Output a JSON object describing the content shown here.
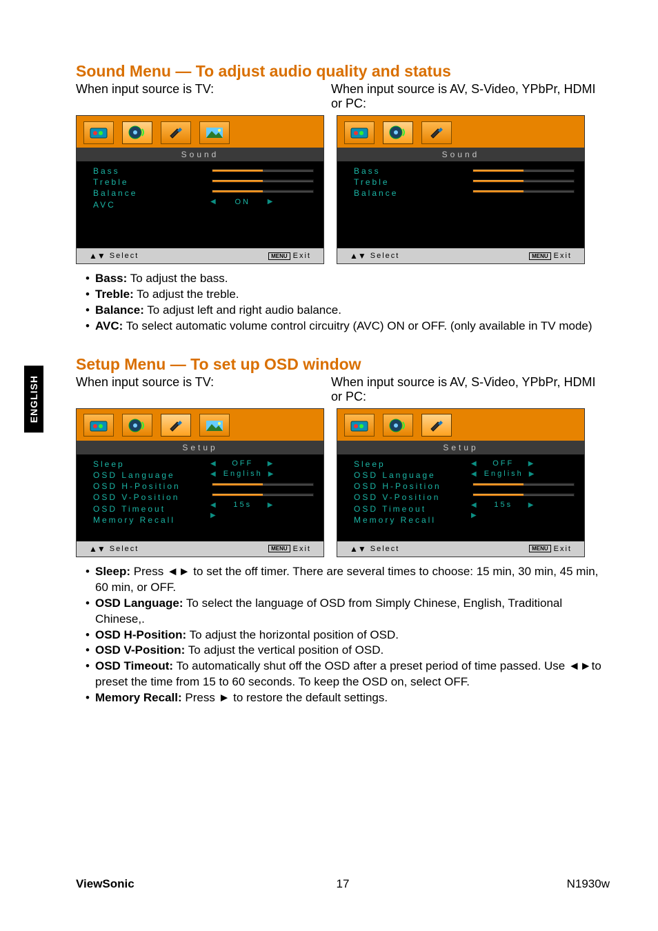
{
  "sideTab": "ENGLISH",
  "section1": {
    "heading": "Sound Menu — To adjust audio quality and status",
    "leftIntro": "When input source is TV:",
    "rightIntro": "When input source is AV, S-Video, YPbPr, HDMI or PC:",
    "panelA": {
      "title": "Sound",
      "rows": [
        "Bass",
        "Treble",
        "Balance",
        "AVC"
      ],
      "avcValue": "ON",
      "select": "Select",
      "menu": "MENU",
      "exit": "Exit"
    },
    "panelB": {
      "title": "Sound",
      "rows": [
        "Bass",
        "Treble",
        "Balance"
      ],
      "select": "Select",
      "menu": "MENU",
      "exit": "Exit"
    },
    "bullets": [
      {
        "label": "Bass:",
        "text": " To adjust the bass."
      },
      {
        "label": "Treble:",
        "text": " To adjust the treble."
      },
      {
        "label": "Balance:",
        "text": " To adjust left and right audio balance."
      },
      {
        "label": "AVC:",
        "text": " To select automatic volume control circuitry (AVC) ON or OFF. (only available in TV mode)"
      }
    ]
  },
  "section2": {
    "heading": "Setup Menu — To set up OSD window",
    "leftIntro": "When input source is TV:",
    "rightIntro": "When input source is AV, S-Video, YPbPr, HDMI or PC:",
    "panelA": {
      "title": "Setup",
      "rows": [
        "Sleep",
        "OSD Language",
        "OSD H-Position",
        "OSD V-Position",
        "OSD Timeout",
        "Memory Recall"
      ],
      "vals": {
        "sleep": "OFF",
        "lang": "English",
        "timeout": "15s"
      },
      "select": "Select",
      "menu": "MENU",
      "exit": "Exit"
    },
    "panelB": {
      "title": "Setup",
      "rows": [
        "Sleep",
        "OSD Language",
        "OSD H-Position",
        "OSD V-Position",
        "OSD Timeout",
        "Memory Recall"
      ],
      "vals": {
        "sleep": "OFF",
        "lang": "English",
        "timeout": "15s"
      },
      "select": "Select",
      "menu": "MENU",
      "exit": "Exit"
    },
    "bullets": [
      {
        "label": "Sleep:",
        "text": " Press ◄► to set the off timer. There are several times to choose: 15 min, 30 min, 45 min, 60 min, or OFF."
      },
      {
        "label": "OSD Language:",
        "text": " To select the language of OSD from Simply Chinese, English, Traditional Chinese,."
      },
      {
        "label": "OSD H-Position:",
        "text": " To adjust the horizontal position of OSD."
      },
      {
        "label": "OSD V-Position:",
        "text": " To adjust the vertical position of OSD."
      },
      {
        "label": "OSD Timeout:",
        "text": " To automatically shut off the OSD after a preset period of time passed. Use ◄►to preset the time from 15 to 60 seconds. To keep the OSD on, select OFF."
      },
      {
        "label": "Memory Recall:",
        "text": " Press ► to restore the default settings."
      }
    ]
  },
  "footer": {
    "brand": "ViewSonic",
    "page": "17",
    "model": "N1930w"
  },
  "icons": {
    "video": "video-icon",
    "speaker": "speaker-icon",
    "tools": "tools-icon",
    "image": "image-icon"
  }
}
